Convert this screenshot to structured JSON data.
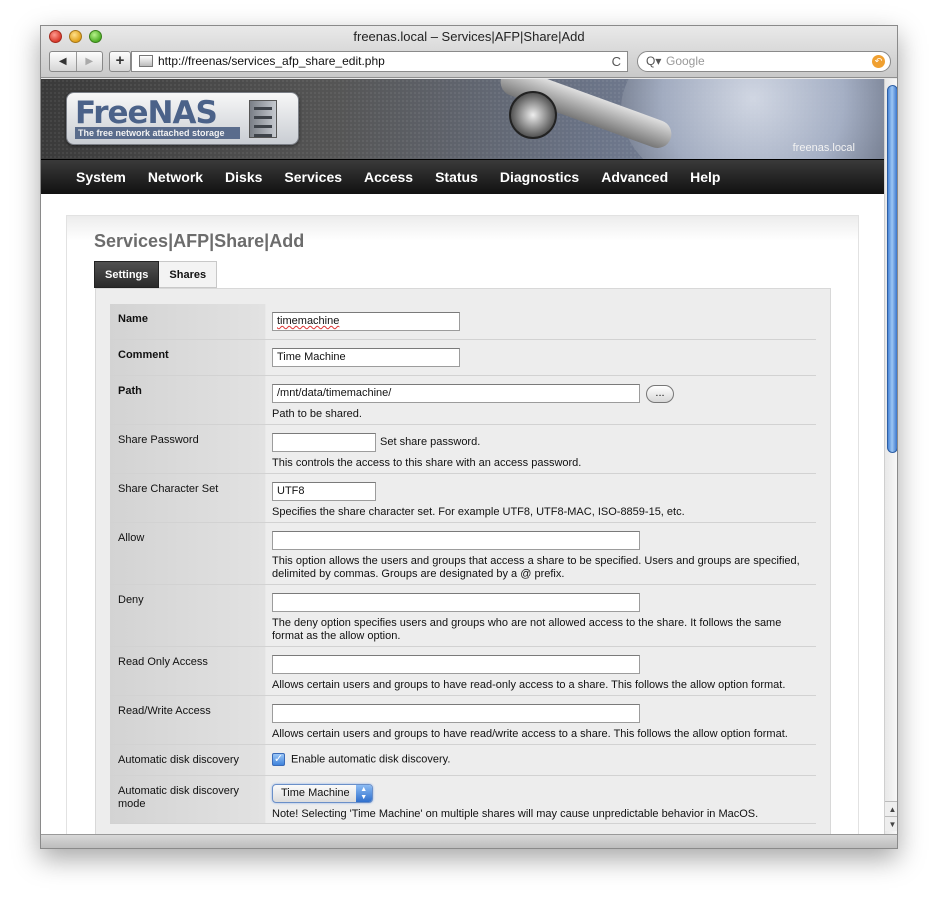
{
  "window": {
    "title": "freenas.local – Services|AFP|Share|Add"
  },
  "browser": {
    "back_label": "◀",
    "forward_label": "▶",
    "add_label": "+",
    "url": "http://freenas/services_afp_share_edit.php",
    "reload_label": "C",
    "search_placeholder": "Google",
    "search_icon_label": "Q▾"
  },
  "header": {
    "logo_title": "FreeNAS",
    "logo_tagline": "The free network attached storage",
    "hostname": "freenas.local"
  },
  "nav": [
    "System",
    "Network",
    "Disks",
    "Services",
    "Access",
    "Status",
    "Diagnostics",
    "Advanced",
    "Help"
  ],
  "page": {
    "title": "Services|AFP|Share|Add",
    "tabs": [
      {
        "label": "Settings",
        "active": true
      },
      {
        "label": "Shares",
        "active": false
      }
    ]
  },
  "form": {
    "name": {
      "label": "Name",
      "value": "timemachine"
    },
    "comment": {
      "label": "Comment",
      "value": "Time Machine"
    },
    "path": {
      "label": "Path",
      "value": "/mnt/data/timemachine/",
      "browse_label": "...",
      "desc": "Path to be shared."
    },
    "share_password": {
      "label": "Share Password",
      "value": "",
      "inline_note": "Set share password.",
      "desc": "This controls the access to this share with an access password."
    },
    "charset": {
      "label": "Share Character Set",
      "value": "UTF8",
      "desc": "Specifies the share character set. For example UTF8, UTF8-MAC, ISO-8859-15, etc."
    },
    "allow": {
      "label": "Allow",
      "value": "",
      "desc": "This option allows the users and groups that access a share to be specified. Users and groups are specified, delimited by commas. Groups are designated by a @ prefix."
    },
    "deny": {
      "label": "Deny",
      "value": "",
      "desc": "The deny option specifies users and groups who are not allowed access to the share. It follows the same format as the allow option."
    },
    "read_only": {
      "label": "Read Only Access",
      "value": "",
      "desc": "Allows certain users and groups to have read-only access to a share. This follows the allow option format."
    },
    "read_write": {
      "label": "Read/Write Access",
      "value": "",
      "desc": "Allows certain users and groups to have read/write access to a share. This follows the allow option format."
    },
    "auto_discovery": {
      "label": "Automatic disk discovery",
      "checked": true,
      "checkbox_label": "Enable automatic disk discovery."
    },
    "auto_discovery_mode": {
      "label": "Automatic disk discovery mode",
      "selected": "Time Machine",
      "desc": "Note! Selecting 'Time Machine' on multiple shares will may cause unpredictable behavior in MacOS."
    }
  },
  "colors": {
    "accent": "#4b6289",
    "nav_bg": "#1a1a1a",
    "panel_bg": "#ededed"
  }
}
